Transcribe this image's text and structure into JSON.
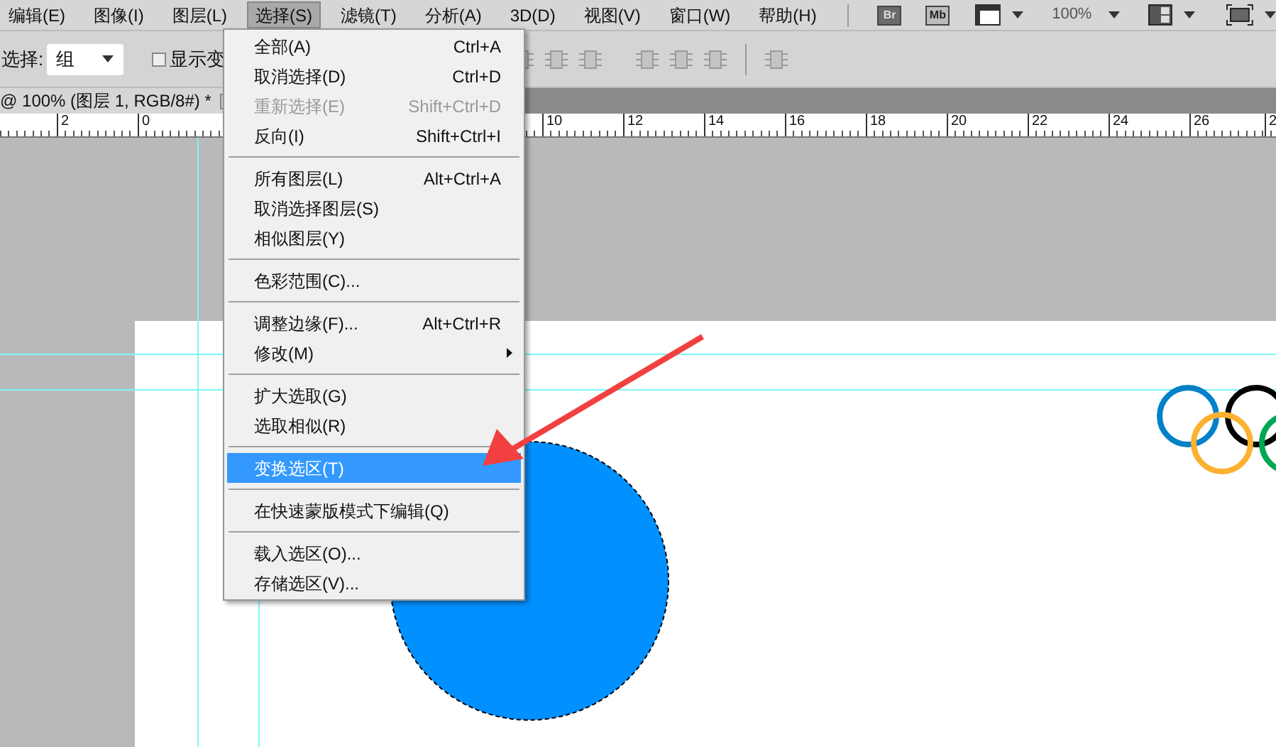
{
  "menubar": [
    {
      "label": "编辑(E)",
      "selected": false
    },
    {
      "label": "图像(I)",
      "selected": false
    },
    {
      "label": "图层(L)",
      "selected": false
    },
    {
      "label": "选择(S)",
      "selected": true
    },
    {
      "label": "滤镜(T)",
      "selected": false
    },
    {
      "label": "分析(A)",
      "selected": false
    },
    {
      "label": "3D(D)",
      "selected": false
    },
    {
      "label": "视图(V)",
      "selected": false
    },
    {
      "label": "窗口(W)",
      "selected": false
    },
    {
      "label": "帮助(H)",
      "selected": false
    }
  ],
  "app_bar": {
    "bridge": "Br",
    "mini_bridge": "Mb",
    "zoom": "100%"
  },
  "options_bar": {
    "select_label": "选择:",
    "select_value": "组",
    "show_transform": {
      "label": "显示变",
      "checked": false
    }
  },
  "document_tab": {
    "title": "@ 100% (图层 1, RGB/8#) *"
  },
  "ruler_labels": [
    "2",
    "0",
    "10",
    "12",
    "14",
    "16",
    "18",
    "20",
    "22",
    "24",
    "26",
    "2"
  ],
  "menu": [
    {
      "kind": "item",
      "label": "全部(A)",
      "shortcut": "Ctrl+A",
      "disabled": false,
      "selected": false,
      "submenu": false
    },
    {
      "kind": "item",
      "label": "取消选择(D)",
      "shortcut": "Ctrl+D",
      "disabled": false,
      "selected": false,
      "submenu": false
    },
    {
      "kind": "item",
      "label": "重新选择(E)",
      "shortcut": "Shift+Ctrl+D",
      "disabled": true,
      "selected": false,
      "submenu": false
    },
    {
      "kind": "item",
      "label": "反向(I)",
      "shortcut": "Shift+Ctrl+I",
      "disabled": false,
      "selected": false,
      "submenu": false
    },
    {
      "kind": "separator"
    },
    {
      "kind": "item",
      "label": "所有图层(L)",
      "shortcut": "Alt+Ctrl+A",
      "disabled": false,
      "selected": false,
      "submenu": false
    },
    {
      "kind": "item",
      "label": "取消选择图层(S)",
      "disabled": false,
      "selected": false,
      "submenu": false
    },
    {
      "kind": "item",
      "label": "相似图层(Y)",
      "disabled": false,
      "selected": false,
      "submenu": false
    },
    {
      "kind": "separator"
    },
    {
      "kind": "item",
      "label": "色彩范围(C)...",
      "disabled": false,
      "selected": false,
      "submenu": false
    },
    {
      "kind": "separator"
    },
    {
      "kind": "item",
      "label": "调整边缘(F)...",
      "shortcut": "Alt+Ctrl+R",
      "disabled": false,
      "selected": false,
      "submenu": false
    },
    {
      "kind": "item",
      "label": "修改(M)",
      "disabled": false,
      "selected": false,
      "submenu": true
    },
    {
      "kind": "separator"
    },
    {
      "kind": "item",
      "label": "扩大选取(G)",
      "disabled": false,
      "selected": false,
      "submenu": false
    },
    {
      "kind": "item",
      "label": "选取相似(R)",
      "disabled": false,
      "selected": false,
      "submenu": false
    },
    {
      "kind": "separator"
    },
    {
      "kind": "item",
      "label": "变换选区(T)",
      "disabled": false,
      "selected": true,
      "submenu": false
    },
    {
      "kind": "separator"
    },
    {
      "kind": "item",
      "label": "在快速蒙版模式下编辑(Q)",
      "disabled": false,
      "selected": false,
      "submenu": false
    },
    {
      "kind": "separator"
    },
    {
      "kind": "item",
      "label": "载入选区(O)...",
      "disabled": false,
      "selected": false,
      "submenu": false
    },
    {
      "kind": "item",
      "label": "存储选区(V)...",
      "disabled": false,
      "selected": false,
      "submenu": false
    }
  ]
}
